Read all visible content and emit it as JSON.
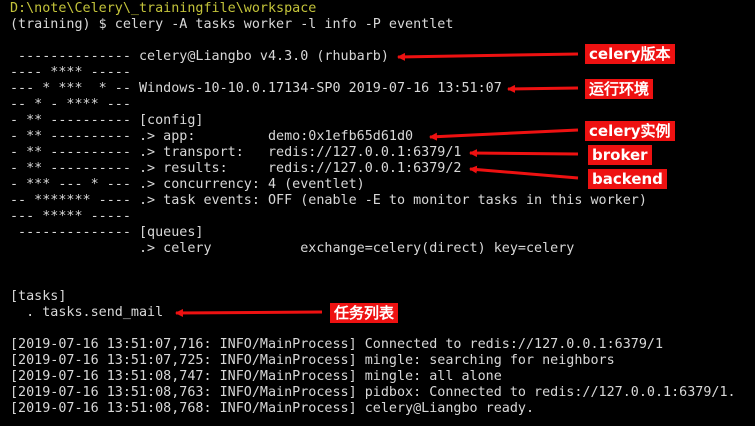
{
  "terminal": {
    "colors": {
      "background": "#000000",
      "text": "#d8d8d8",
      "path": "#c3c33a",
      "annotation_bg": "#ee1111",
      "annotation_text": "#ffffff",
      "arrow": "#ee1111"
    },
    "lines": [
      "D:\\note\\Celery\\_trainingfile\\workspace",
      "(training) $ celery -A tasks worker -l info -P eventlet",
      "",
      " -------------- celery@Liangbo v4.3.0 (rhubarb)",
      "---- **** -----",
      "--- * ***  * -- Windows-10-10.0.17134-SP0 2019-07-16 13:51:07",
      "-- * - **** ---",
      "- ** ---------- [config]",
      "- ** ---------- .> app:         demo:0x1efb65d61d0",
      "- ** ---------- .> transport:   redis://127.0.0.1:6379/1",
      "- ** ---------- .> results:     redis://127.0.0.1:6379/2",
      "- *** --- * --- .> concurrency: 4 (eventlet)",
      "-- ******* ---- .> task events: OFF (enable -E to monitor tasks in this worker)",
      "--- ***** -----",
      " -------------- [queues]",
      "                .> celery           exchange=celery(direct) key=celery",
      "",
      "",
      "[tasks]",
      "  . tasks.send_mail",
      "",
      "[2019-07-16 13:51:07,716: INFO/MainProcess] Connected to redis://127.0.0.1:6379/1",
      "[2019-07-16 13:51:07,725: INFO/MainProcess] mingle: searching for neighbors",
      "[2019-07-16 13:51:08,747: INFO/MainProcess] mingle: all alone",
      "[2019-07-16 13:51:08,763: INFO/MainProcess] pidbox: Connected to redis://127.0.0.1:6379/1.",
      "[2019-07-16 13:51:08,768: INFO/MainProcess] celery@Liangbo ready."
    ]
  },
  "annotations": {
    "version": "celery版本",
    "environment": "运行环境",
    "instance": "celery实例",
    "broker": "broker",
    "backend": "backend",
    "task_list": "任务列表"
  }
}
